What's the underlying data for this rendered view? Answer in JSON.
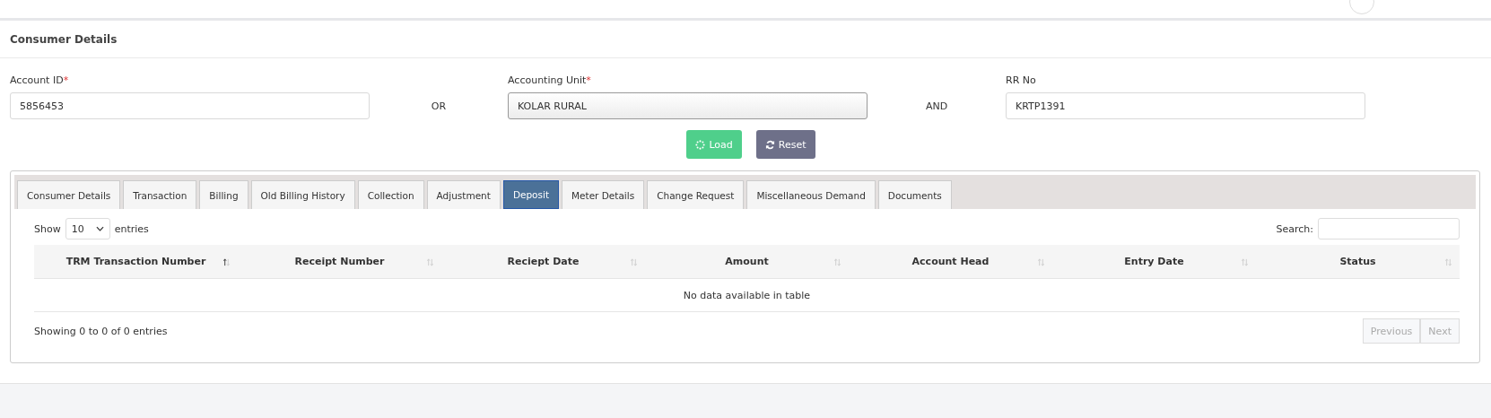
{
  "page_title": "Consumer Details",
  "fields": [
    {
      "label": "Account ID",
      "required_mark": "*",
      "value": "5856453",
      "kind": "text"
    },
    {
      "connector": "OR"
    },
    {
      "label": "Accounting Unit",
      "required_mark": "*",
      "value": "KOLAR RURAL",
      "kind": "select"
    },
    {
      "connector": "AND"
    },
    {
      "label": "RR No",
      "value": "KRTP1391",
      "kind": "text"
    }
  ],
  "buttons": [
    {
      "label": "Load",
      "kind": "primary"
    },
    {
      "label": "Reset",
      "kind": "secondary"
    }
  ],
  "tabs": [
    {
      "label": "Consumer Details",
      "selected": false
    },
    {
      "label": "Transaction",
      "selected": false
    },
    {
      "label": "Billing",
      "selected": false
    },
    {
      "label": "Old Billing History",
      "selected": false
    },
    {
      "label": "Collection",
      "selected": false
    },
    {
      "label": "Adjustment",
      "selected": false
    },
    {
      "label": "Deposit",
      "selected": true
    },
    {
      "label": "Meter Details",
      "selected": false
    },
    {
      "label": "Change Request",
      "selected": false
    },
    {
      "label": "Miscellaneous Demand",
      "selected": false
    },
    {
      "label": "Documents",
      "selected": false
    }
  ],
  "table": {
    "show_label": "Show",
    "page_size": "10",
    "entries_label": "entries",
    "search_label": "Search:",
    "columns": [
      {
        "label": "TRM Transaction Number",
        "sorted": true
      },
      {
        "label": "Receipt Number",
        "sorted": false
      },
      {
        "label": "Reciept Date",
        "sorted": false
      },
      {
        "label": "Amount",
        "sorted": false
      },
      {
        "label": "Account Head",
        "sorted": false
      },
      {
        "label": "Entry Date",
        "sorted": false
      },
      {
        "label": "Status",
        "sorted": false
      }
    ],
    "empty_message": "No data available in table",
    "info": "Showing 0 to 0 of 0 entries",
    "pager": [
      {
        "label": "Previous",
        "disabled": true
      },
      {
        "label": "Next",
        "disabled": true
      }
    ]
  }
}
